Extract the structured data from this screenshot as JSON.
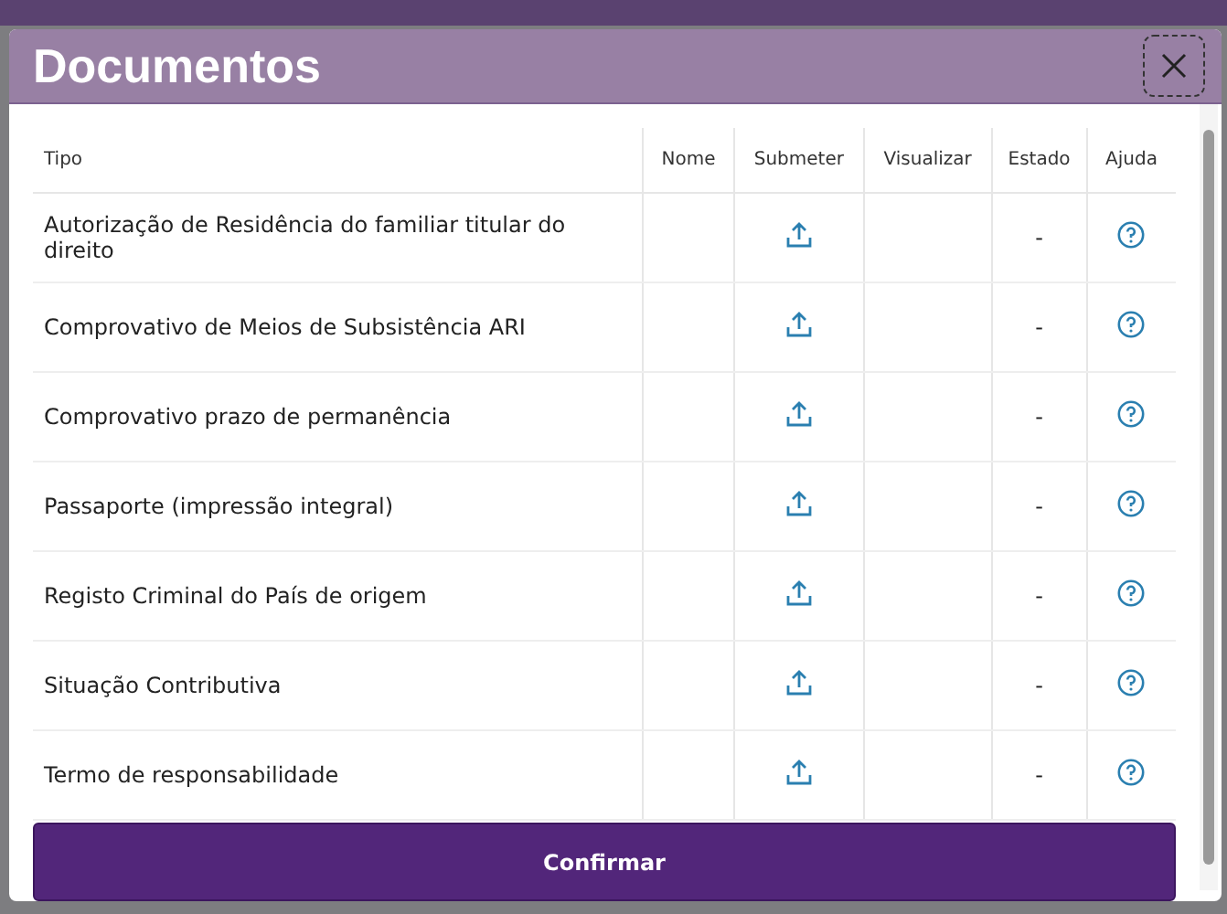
{
  "dialog": {
    "title": "Documentos"
  },
  "table": {
    "columns": [
      "Tipo",
      "Nome",
      "Submeter",
      "Visualizar",
      "Estado",
      "Ajuda"
    ],
    "rows": [
      {
        "tipo": "Autorização de Residência do familiar titular do direito",
        "estado": "-"
      },
      {
        "tipo": "Comprovativo de Meios de Subsistência ARI",
        "estado": "-"
      },
      {
        "tipo": "Comprovativo prazo de permanência",
        "estado": "-"
      },
      {
        "tipo": "Passaporte (impressão integral)",
        "estado": "-"
      },
      {
        "tipo": "Registo Criminal do País de origem",
        "estado": "-"
      },
      {
        "tipo": "Situação Contributiva",
        "estado": "-"
      },
      {
        "tipo": "Termo de responsabilidade",
        "estado": "-"
      }
    ]
  },
  "confirm_button": "Confirmar"
}
